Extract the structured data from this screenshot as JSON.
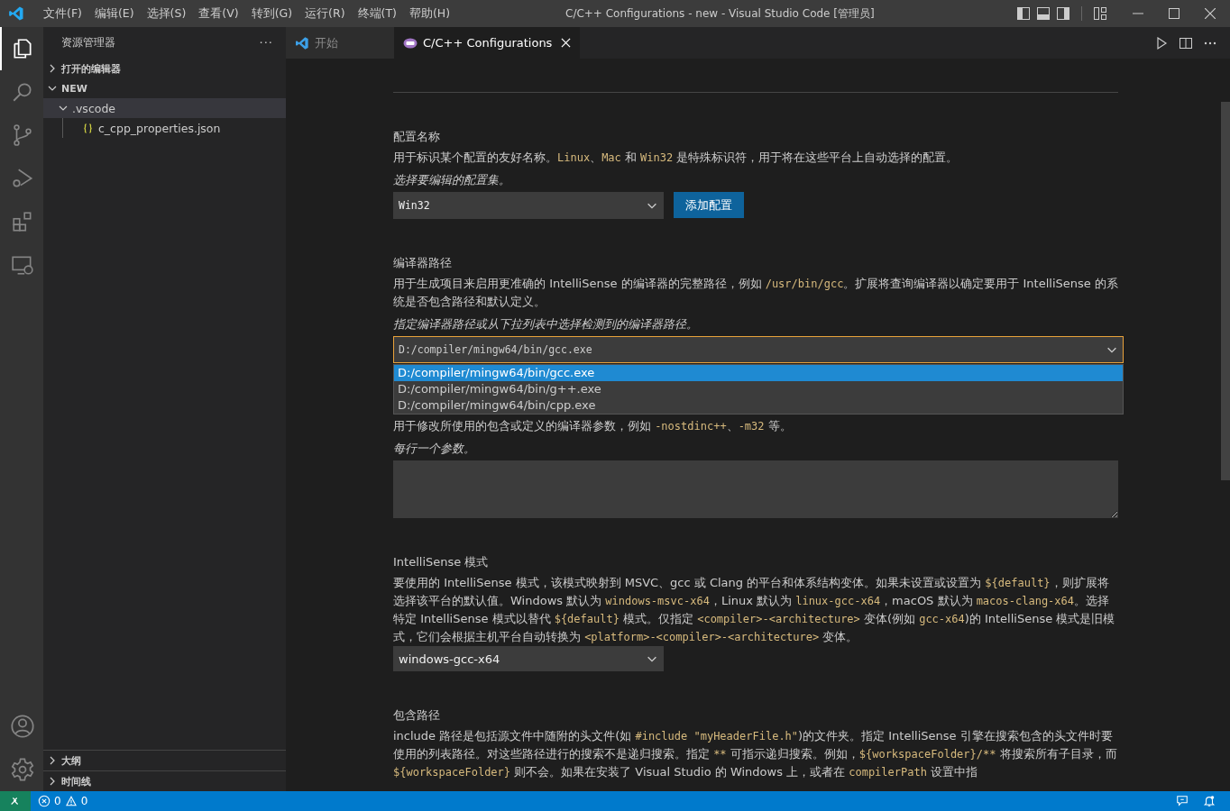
{
  "title_bar": {
    "menu": [
      "文件(F)",
      "编辑(E)",
      "选择(S)",
      "查看(V)",
      "转到(G)",
      "运行(R)",
      "终端(T)",
      "帮助(H)"
    ],
    "title": "C/C++ Configurations - new - Visual Studio Code [管理员]"
  },
  "sidebar": {
    "title": "资源管理器",
    "more": "···",
    "sections": [
      {
        "label": "打开的编辑器",
        "expanded": false
      },
      {
        "label": "NEW",
        "expanded": true
      }
    ],
    "tree": [
      {
        "label": ".vscode",
        "kind": "folder",
        "expanded": true,
        "selected": true,
        "children": [
          {
            "label": "c_cpp_properties.json",
            "kind": "json",
            "selected": false
          }
        ]
      }
    ],
    "bottom_sections": [
      {
        "label": "大纲",
        "expanded": false
      },
      {
        "label": "时间线",
        "expanded": false
      }
    ]
  },
  "tabs": [
    {
      "label": "开始",
      "kind": "vscode",
      "selected": false
    },
    {
      "label": "C/C++ Configurations",
      "kind": "cpp",
      "selected": true
    }
  ],
  "sections": [
    {
      "heading": "配置名称",
      "description": [
        {
          "text": "用于标识某个配置的友好名称。"
        },
        {
          "text": "Linux",
          "code": true
        },
        {
          "text": "、"
        },
        {
          "text": "Mac",
          "code": true
        },
        {
          "text": " 和 "
        },
        {
          "text": "Win32",
          "code": true
        },
        {
          "text": " 是特殊标识符，用于将在这些平台上自动选择的配置。"
        }
      ],
      "hint": "选择要编辑的配置集。",
      "control": {
        "kind": "select",
        "value": "Win32",
        "monospace": true
      },
      "button": "添加配置"
    },
    {
      "heading": "编译器路径",
      "description": [
        {
          "text": "用于生成项目来启用更准确的 IntelliSense 的编译器的完整路径，例如 "
        },
        {
          "text": "/usr/bin/gcc",
          "code": true
        },
        {
          "text": "。扩展将查询编译器以确定要用于 IntelliSense 的系统是否包含路径和默认定义。"
        }
      ],
      "hint": "指定编译器路径或从下拉列表中选择检测到的编译器路径。",
      "control": {
        "kind": "combo",
        "value": "D:/compiler/mingw64/bin/gcc.exe",
        "focused": true,
        "options": [
          {
            "label": "D:/compiler/mingw64/bin/gcc.exe",
            "selected": true
          },
          {
            "label": "D:/compiler/mingw64/bin/g++.exe",
            "selected": false
          },
          {
            "label": "D:/compiler/mingw64/bin/cpp.exe",
            "selected": false
          }
        ]
      }
    },
    {
      "description": [
        {
          "text": "用于修改所使用的包含或定义的编译器参数，例如 "
        },
        {
          "text": "-nostdinc++",
          "code": true
        },
        {
          "text": "、"
        },
        {
          "text": "-m32",
          "code": true
        },
        {
          "text": " 等。"
        }
      ],
      "hint": "每行一个参数。",
      "control": {
        "kind": "textarea"
      }
    },
    {
      "heading": "IntelliSense 模式",
      "description": [
        {
          "text": "要使用的 IntelliSense 模式，该模式映射到 MSVC、gcc 或 Clang 的平台和体系结构变体。如果未设置或设置为 "
        },
        {
          "text": "${default}",
          "code": true
        },
        {
          "text": "，则扩展将选择该平台的默认值。Windows 默认为 "
        },
        {
          "text": "windows-msvc-x64",
          "code": true
        },
        {
          "text": "，Linux 默认为 "
        },
        {
          "text": "linux-gcc-x64",
          "code": true
        },
        {
          "text": "，macOS 默认为 "
        },
        {
          "text": "macos-clang-x64",
          "code": true
        },
        {
          "text": "。选择特定 IntelliSense 模式以替代 "
        },
        {
          "text": "${default}",
          "code": true
        },
        {
          "text": " 模式。仅指定 "
        },
        {
          "text": "<compiler>-<architecture>",
          "code": true
        },
        {
          "text": " 变体(例如 "
        },
        {
          "text": "gcc-x64",
          "code": true
        },
        {
          "text": ")的 IntelliSense 模式是旧模式，它们会根据主机平台自动转换为 "
        },
        {
          "text": "<platform>-<compiler>-<architecture>",
          "code": true
        },
        {
          "text": " 变体。"
        }
      ],
      "control": {
        "kind": "select",
        "value": "windows-gcc-x64",
        "monospace": false
      }
    },
    {
      "heading": "包含路径",
      "description": [
        {
          "text": "include 路径是包括源文件中随附的头文件(如 "
        },
        {
          "text": "#include \"myHeaderFile.h\"",
          "code": true
        },
        {
          "text": ")的文件夹。指定 IntelliSense 引擎在搜索包含的头文件时要使用的列表路径。对这些路径进行的搜索不是递归搜索。指定 "
        },
        {
          "text": "**",
          "code": true
        },
        {
          "text": " 可指示递归搜索。例如，"
        },
        {
          "text": "${workspaceFolder}/**",
          "code": true
        },
        {
          "text": " 将搜索所有子目录，而 "
        },
        {
          "text": "${workspaceFolder}",
          "code": true
        },
        {
          "text": " 则不会。如果在安装了 Visual Studio 的 Windows 上，或者在 "
        },
        {
          "text": "compilerPath",
          "code": true
        },
        {
          "text": " 设置中指"
        }
      ]
    }
  ],
  "status_bar": {
    "errors": "0",
    "warnings": "0"
  }
}
